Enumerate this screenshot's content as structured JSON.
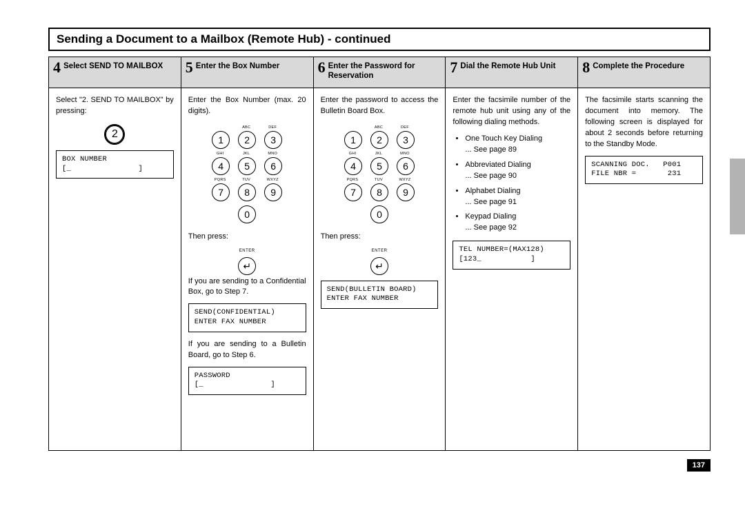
{
  "page_title": "Sending a Document to a Mailbox (Remote Hub) - continued",
  "page_number": "137",
  "columns": [
    {
      "num": "4",
      "title": "Select SEND TO MAILBOX",
      "intro": "Select \"2. SEND TO MAILBOX\" by pressing:",
      "lcd1": "BOX NUMBER\n[_               ]"
    },
    {
      "num": "5",
      "title": "Enter the Box Number",
      "intro": "Enter the Box Number (max. 20 digits).",
      "then_press": "Then press:",
      "note1": "If you are sending to a Confi­dential Box, go to Step 7.",
      "lcd1": "SEND(CONFIDENTIAL)\nENTER FAX NUMBER",
      "note2": "If you are sending to a Bulletin Board, go to Step 6.",
      "lcd2": "PASSWORD\n[_               ]"
    },
    {
      "num": "6",
      "title": "Enter the Password for Reservation",
      "intro": "Enter the password to access the Bulletin Board Box.",
      "then_press": "Then press:",
      "lcd1": "SEND(BULLETIN BOARD)\nENTER FAX NUMBER"
    },
    {
      "num": "7",
      "title": "Dial the Remote Hub Unit",
      "intro": "Enter the facsimile number of the remote hub unit using any of the following dialing methods.",
      "dial_methods": [
        {
          "name": "One Touch Key Dialing",
          "ref": "... See page 89"
        },
        {
          "name": "Abbreviated Dialing",
          "ref": "... See page 90"
        },
        {
          "name": "Alphabet Dialing",
          "ref": "... See page 91"
        },
        {
          "name": "Keypad Dialing",
          "ref": "... See page 92"
        }
      ],
      "lcd1": "TEL NUMBER=(MAX128)\n[123_           ]"
    },
    {
      "num": "8",
      "title": "Complete the Procedure",
      "intro": "The facsimile starts scanning the document into memory.  The following screen is displayed for about 2 seconds before return­ing to the Standby Mode.",
      "lcd1": "SCANNING DOC.   P001\nFILE NBR =       231"
    }
  ],
  "keypad_labels": {
    "row1": [
      "",
      "ABC",
      "DEF"
    ],
    "row2": [
      "GHI",
      "JKL",
      "MNO"
    ],
    "row3": [
      "PQRS",
      "TUV",
      "WXYZ"
    ]
  },
  "enter_label": "ENTER"
}
